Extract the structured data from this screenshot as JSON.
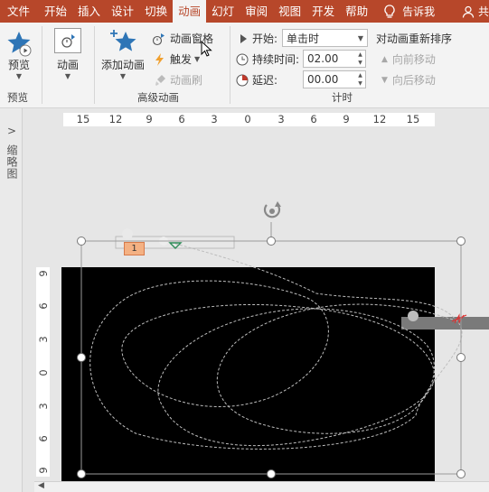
{
  "tabs": [
    {
      "label": "文件",
      "active": false
    },
    {
      "label": "开始",
      "active": false
    },
    {
      "label": "插入",
      "active": false
    },
    {
      "label": "设计",
      "active": false
    },
    {
      "label": "切换",
      "active": false
    },
    {
      "label": "动画",
      "active": true
    },
    {
      "label": "幻灯",
      "active": false
    },
    {
      "label": "审阅",
      "active": false
    },
    {
      "label": "视图",
      "active": false
    },
    {
      "label": "开发",
      "active": false
    },
    {
      "label": "帮助",
      "active": false
    }
  ],
  "tell_me": "告诉我",
  "share": "共",
  "ribbon": {
    "preview": {
      "button": "预览",
      "group": "预览"
    },
    "animation": {
      "button": "动画"
    },
    "advanced": {
      "add_animation": "添加动画",
      "pane": "动画窗格",
      "trigger": "触发",
      "painter": "动画刷",
      "group": "高级动画"
    },
    "timing": {
      "start_label": "开始:",
      "start_value": "单击时",
      "duration_label": "持续时间:",
      "duration_value": "02.00",
      "delay_label": "延迟:",
      "delay_value": "00.00",
      "reorder_title": "对动画重新排序",
      "move_earlier": "向前移动",
      "move_later": "向后移动",
      "group": "计时"
    }
  },
  "left_pane": {
    "label": "缩略图"
  },
  "hruler": [
    "15",
    "12",
    "9",
    "6",
    "3",
    "0",
    "3",
    "6",
    "9",
    "12",
    "15"
  ],
  "vruler": [
    "9",
    "6",
    "3",
    "0",
    "3",
    "6",
    "9"
  ],
  "animation_badge": "1",
  "colors": {
    "accent": "#b7472a",
    "ribbon": "#f3f3f3",
    "slide": "#000000"
  }
}
